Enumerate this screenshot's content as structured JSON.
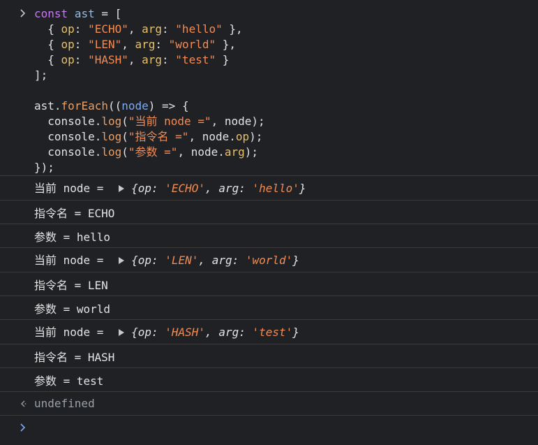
{
  "code": {
    "kw_const": "const",
    "var_ast": "ast",
    "assign": " = [",
    "entries": [
      {
        "op": "\"ECHO\"",
        "arg": "\"hello\""
      },
      {
        "op": "\"LEN\"",
        "arg": "\"world\""
      },
      {
        "op": "\"HASH\"",
        "arg": "\"test\""
      }
    ],
    "key_op": "op",
    "key_arg": "arg",
    "close_array": "];",
    "obj_ref": "ast",
    "method": "forEach",
    "param": "node",
    "arrow": ") => {",
    "console": "console",
    "log": "log",
    "str1": "\"当前 node =\"",
    "str2": "\"指令名 =\"",
    "str3": "\"参数 =\"",
    "node": "node",
    "close_fn": "});"
  },
  "logs": [
    {
      "type": "object",
      "label": "当前 node = ",
      "op": "'ECHO'",
      "arg": "'hello'"
    },
    {
      "type": "text",
      "text": "指令名 = ECHO"
    },
    {
      "type": "text",
      "text": "参数 = hello"
    },
    {
      "type": "object",
      "label": "当前 node = ",
      "op": "'LEN'",
      "arg": "'world'"
    },
    {
      "type": "text",
      "text": "指令名 = LEN"
    },
    {
      "type": "text",
      "text": "参数 = world"
    },
    {
      "type": "object",
      "label": "当前 node = ",
      "op": "'HASH'",
      "arg": "'test'"
    },
    {
      "type": "text",
      "text": "指令名 = HASH"
    },
    {
      "type": "text",
      "text": "参数 = test"
    }
  ],
  "result": {
    "value": "undefined"
  },
  "icons": {
    "input_prompt": "chevron-right-icon",
    "result_arrow": "return-arrow-icon",
    "prompt_caret": "chevron-right-icon",
    "expand": "triangle-right-icon"
  },
  "colors": {
    "background": "#202124",
    "keyword": "#c678f5",
    "string": "#f28b54",
    "property": "#e8c26a",
    "function": "#e7a06a",
    "prompt_blue": "#7cacf8"
  }
}
